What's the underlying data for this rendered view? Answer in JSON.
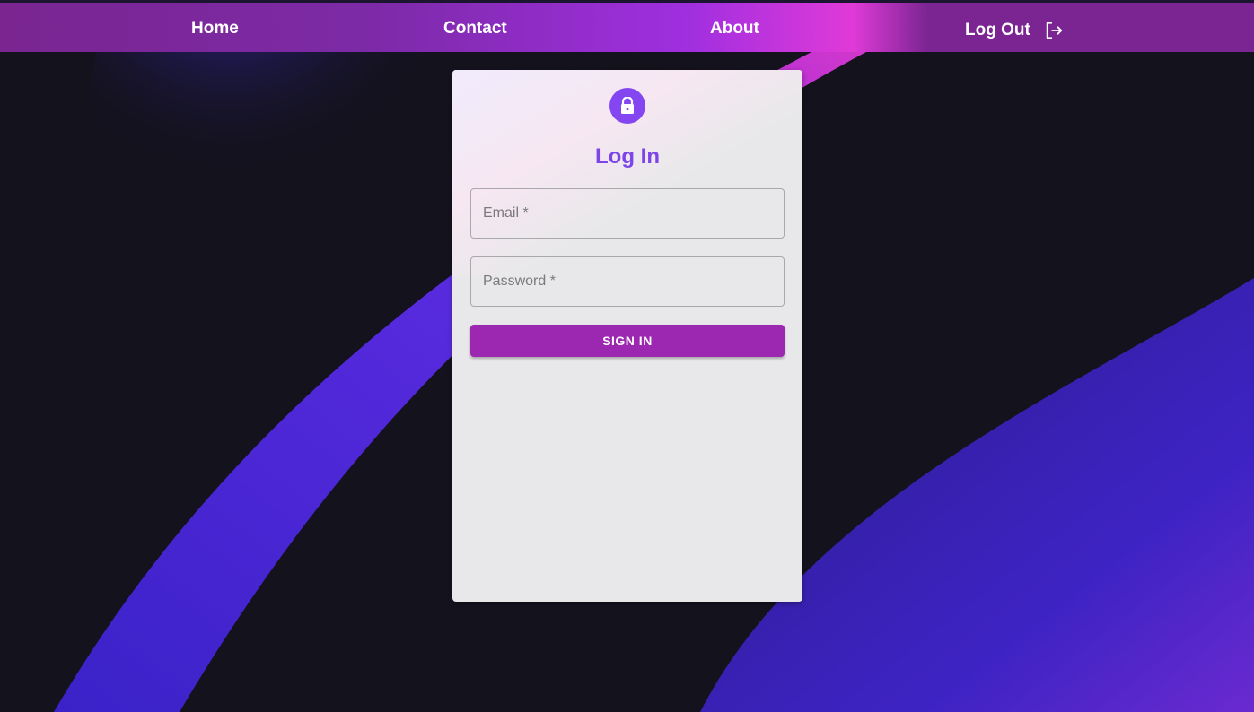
{
  "nav": {
    "home_label": "Home",
    "contact_label": "Contact",
    "about_label": "About",
    "logout_label": "Log Out",
    "logout_icon": "logout-icon"
  },
  "login": {
    "lock_icon": "lock-icon",
    "title": "Log In",
    "email_placeholder": "Email *",
    "email_value": "",
    "password_placeholder": "Password *",
    "password_value": "",
    "signin_label": "SIGN IN"
  },
  "colors": {
    "accent": "#9c27b0",
    "title": "#7c45e8",
    "avatar": "#8446f0",
    "background": "#14121d"
  }
}
